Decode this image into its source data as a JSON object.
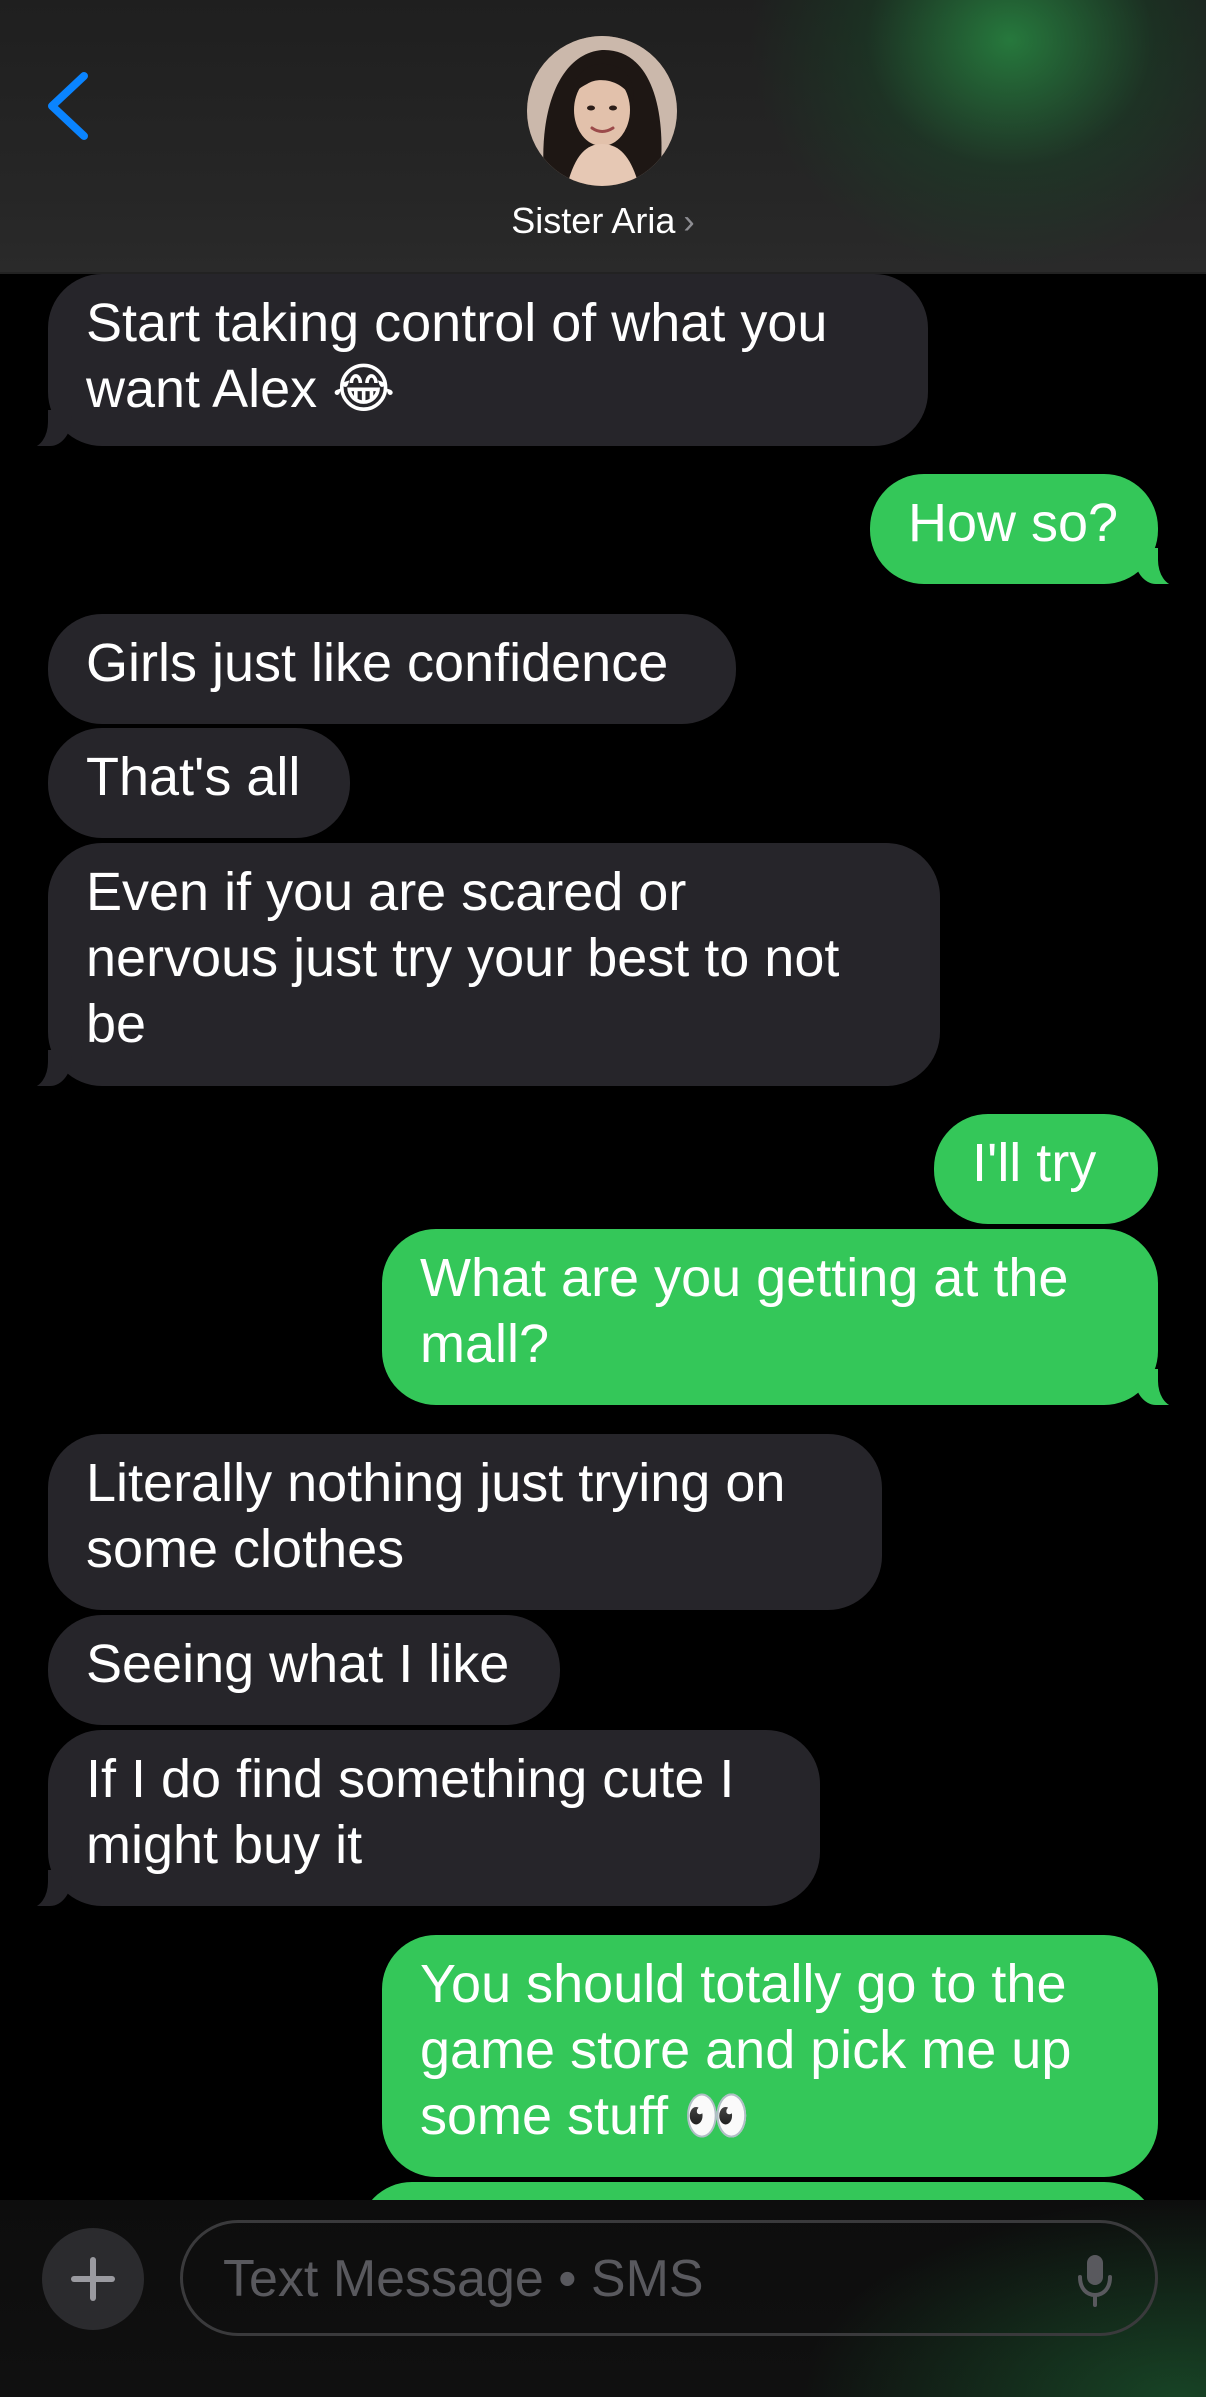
{
  "header": {
    "contact_name": "Sister Aria",
    "back_icon": "chevron-left-icon",
    "contact_chevron": "›"
  },
  "messages": [
    {
      "direction": "incoming",
      "text": "Start taking control of what you\nwant Alex 😂"
    },
    {
      "direction": "outgoing",
      "text": "How so?"
    },
    {
      "direction": "incoming",
      "text": "Girls just like confidence"
    },
    {
      "direction": "incoming",
      "text": "That's all"
    },
    {
      "direction": "incoming",
      "text": "Even if you are scared or\nnervous just try your best to not\nbe"
    },
    {
      "direction": "outgoing",
      "text": "I'll try"
    },
    {
      "direction": "outgoing",
      "text": "What are you getting at the\nmall?"
    },
    {
      "direction": "incoming",
      "text": "Literally nothing just trying on\nsome clothes"
    },
    {
      "direction": "incoming",
      "text": "Seeing what I like"
    },
    {
      "direction": "incoming",
      "text": "If I do find something cute I\nmight buy it"
    },
    {
      "direction": "outgoing",
      "text": "You should totally go to the\ngame store and pick me up\nsome stuff 👀"
    }
  ],
  "composer": {
    "placeholder": "Text Message • SMS",
    "plus_icon": "plus-icon",
    "mic_icon": "microphone-icon"
  },
  "colors": {
    "incoming_bubble": "#26252a",
    "outgoing_bubble": "#34c759",
    "accent_blue": "#0a84ff",
    "background": "#000000"
  }
}
